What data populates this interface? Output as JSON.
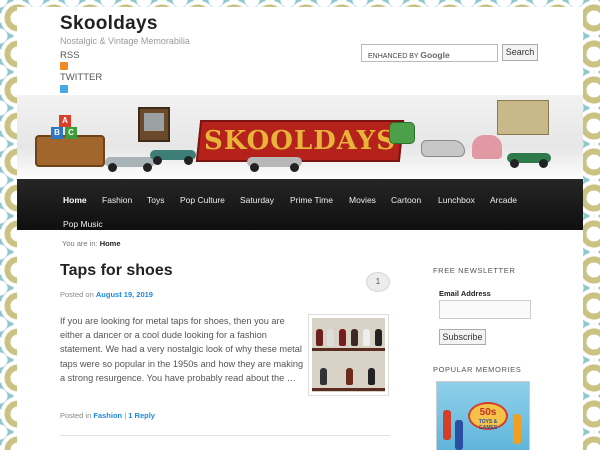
{
  "site": {
    "title": "Skooldays",
    "description": "Nostalgic & Vintage Memorabilia",
    "rss_label": "RSS",
    "twitter_label": "TWITTER"
  },
  "search": {
    "enhanced_by": "ENHANCED BY",
    "brand": "Google",
    "button_label": "Search"
  },
  "banner": {
    "logo_text": "SKOOLDAYS",
    "blocks": [
      "A",
      "B",
      "C"
    ]
  },
  "nav": {
    "items": [
      {
        "label": "Home",
        "active": true
      },
      {
        "label": "Fashion"
      },
      {
        "label": "Toys"
      },
      {
        "label": "Pop Culture"
      },
      {
        "label": "Saturday"
      },
      {
        "label": "Prime Time"
      },
      {
        "label": "Movies"
      },
      {
        "label": "Cartoon"
      },
      {
        "label": "Lunchbox"
      },
      {
        "label": "Arcade"
      },
      {
        "label": "Pop Music"
      }
    ]
  },
  "breadcrumb": {
    "prefix": "You are in:",
    "current": "Home"
  },
  "post": {
    "title": "Taps for shoes",
    "comment_count": "1",
    "posted_prefix": "Posted on",
    "date": "August 19, 2019",
    "excerpt": "If you are looking for metal taps for shoes, then you are either a dancer or a cool dude looking for a fashion statement. We had a very nostalgic look of why these metal taps were so popular in the 1950s and how they are making a strong resurgence. You have probably read about the …",
    "category_prefix": "Posted in",
    "category": "Fashion",
    "separator": "|",
    "reply_link": "1 Reply"
  },
  "sidebar": {
    "newsletter": {
      "title": "FREE NEWSLETTER",
      "email_label": "Email Address",
      "subscribe_label": "Subscribe"
    },
    "memories": {
      "title": "POPULAR MEMORIES",
      "badge_text": "50s",
      "badge_sub": "TOYS & GAMES"
    }
  },
  "colors": {
    "nav_background": "#1a1a1a",
    "link_accent": "#1b8be0",
    "banner_logo_red": "#b5221b",
    "banner_logo_gold": "#e8b53a"
  },
  "icons": {
    "rss": "rss-icon",
    "twitter": "twitter-icon"
  }
}
